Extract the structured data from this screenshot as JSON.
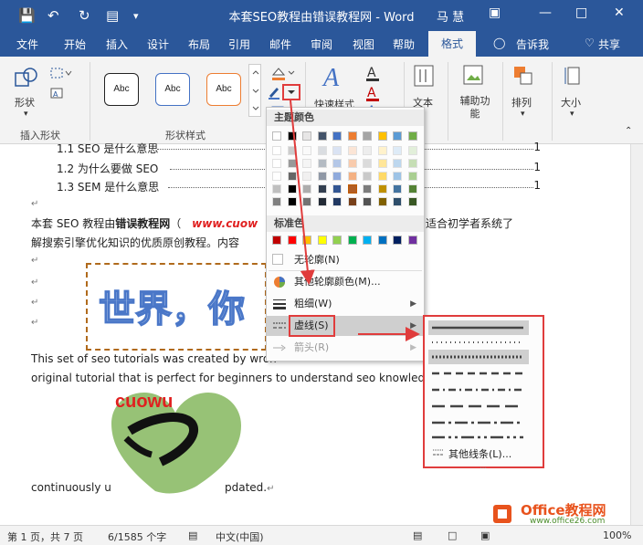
{
  "titlebar": {
    "doc_title": "本套SEO教程由错误教程网 - Word",
    "user": "马 慧",
    "icons": [
      "save-icon",
      "undo-icon",
      "redo-icon",
      "print-preview-icon",
      "customize-icon",
      "ribbon-display-icon",
      "minimize-icon",
      "maximize-icon",
      "close-icon"
    ]
  },
  "tabs": {
    "file": "文件",
    "home": "开始",
    "insert": "插入",
    "design": "设计",
    "layout": "布局",
    "references": "引用",
    "mailings": "邮件",
    "review": "审阅",
    "view": "视图",
    "help": "帮助",
    "format": "格式",
    "tell_me": "告诉我",
    "share": "共享"
  },
  "ribbon": {
    "shape_label": "形状",
    "insert_shapes_group": "插入形状",
    "shape_styles_group": "形状样式",
    "style_samples": [
      "Abc",
      "Abc",
      "Abc"
    ],
    "quick_style_label": "快速样式",
    "text_label": "文本",
    "alt_text_label": "辅助功\n能",
    "arrange_label": "排列",
    "size_label": "大小"
  },
  "document": {
    "toc": [
      {
        "text": "1.1 SEO 是什么意思",
        "page": "1"
      },
      {
        "text": "1.2  为什么要做 SEO",
        "page": "1"
      },
      {
        "text": "1.3 SEM 是什么意思",
        "page": "1"
      }
    ],
    "para1_a": "本套 SEO 教程由",
    "para1_bold": "错误教程网",
    "para1_b": "（",
    "para1_red": "www.cuow",
    "para1_c": "适合初学者系统了",
    "para2": "解搜索引擎优化知识的优质原创教程。内容",
    "wordart": "世界，你",
    "english1": "This set of seo tutorials was created by wron",
    "english2": "original tutorial that is perfect for beginners to understand seo knowled",
    "english3_a": "continuously u",
    "english3_b": "pdated.",
    "heart_text": "cuowu"
  },
  "status": {
    "page": "第 1 页，共 7 页",
    "words": "6/1585 个字",
    "language": "中文(中国)",
    "zoom": "100%"
  },
  "color_menu": {
    "theme_colors_label": "主题颜色",
    "standard_colors_label": "标准色",
    "no_outline": "无轮廓(N)",
    "more_colors": "其他轮廓颜色(M)...",
    "weight": "粗细(W)",
    "dashes": "虚线(S)",
    "arrows": "箭头(R)",
    "theme_top": [
      "#ffffff",
      "#000000",
      "#e7e6e6",
      "#44546a",
      "#4472c4",
      "#ed7d31",
      "#a5a5a5",
      "#ffc000",
      "#5b9bd5",
      "#70ad47"
    ],
    "standard": [
      "#c00000",
      "#ff0000",
      "#ffc000",
      "#ffff00",
      "#92d050",
      "#00b050",
      "#00b0f0",
      "#0070c0",
      "#002060",
      "#7030a0"
    ]
  },
  "dash_menu": {
    "more_lines": "其他线条(L)..."
  },
  "watermark": {
    "brand": "Office教程网",
    "url": "www.office26.com"
  }
}
